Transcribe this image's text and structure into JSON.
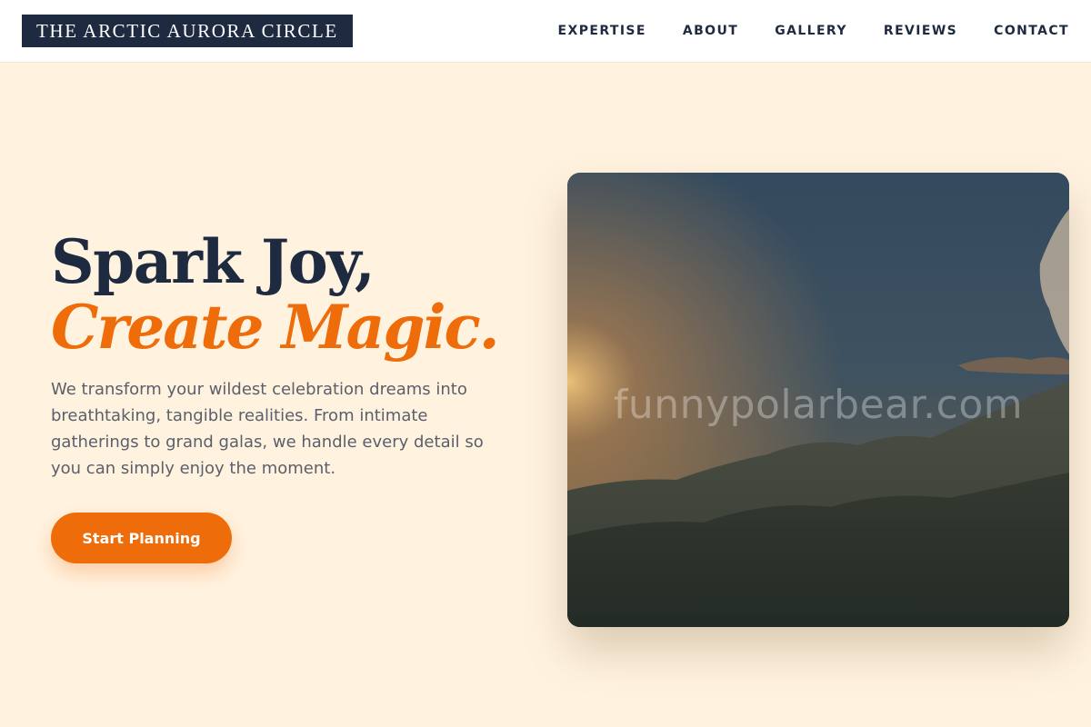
{
  "brand": {
    "name": "THE ARCTIC AURORA CIRCLE"
  },
  "nav": {
    "links": [
      {
        "label": "EXPERTISE"
      },
      {
        "label": "ABOUT"
      },
      {
        "label": "GALLERY"
      },
      {
        "label": "REVIEWS"
      },
      {
        "label": "CONTACT"
      }
    ]
  },
  "hero": {
    "headline": "Spark Joy,",
    "headline_accent": "Create Magic.",
    "lead": "We transform your wildest celebration dreams into breathtaking, tangible realities. From intimate gatherings to grand galas, we handle every detail so you can simply enjoy the moment.",
    "cta_label": "Start Planning",
    "image": {
      "subject": "mountain-sunset-photo",
      "watermark": "funnypolarbear.com"
    }
  },
  "colors": {
    "background": "#fff3e0",
    "navy": "#1e2a3f",
    "accent": "#ef6c0a",
    "body_text": "#5a5f6b"
  }
}
